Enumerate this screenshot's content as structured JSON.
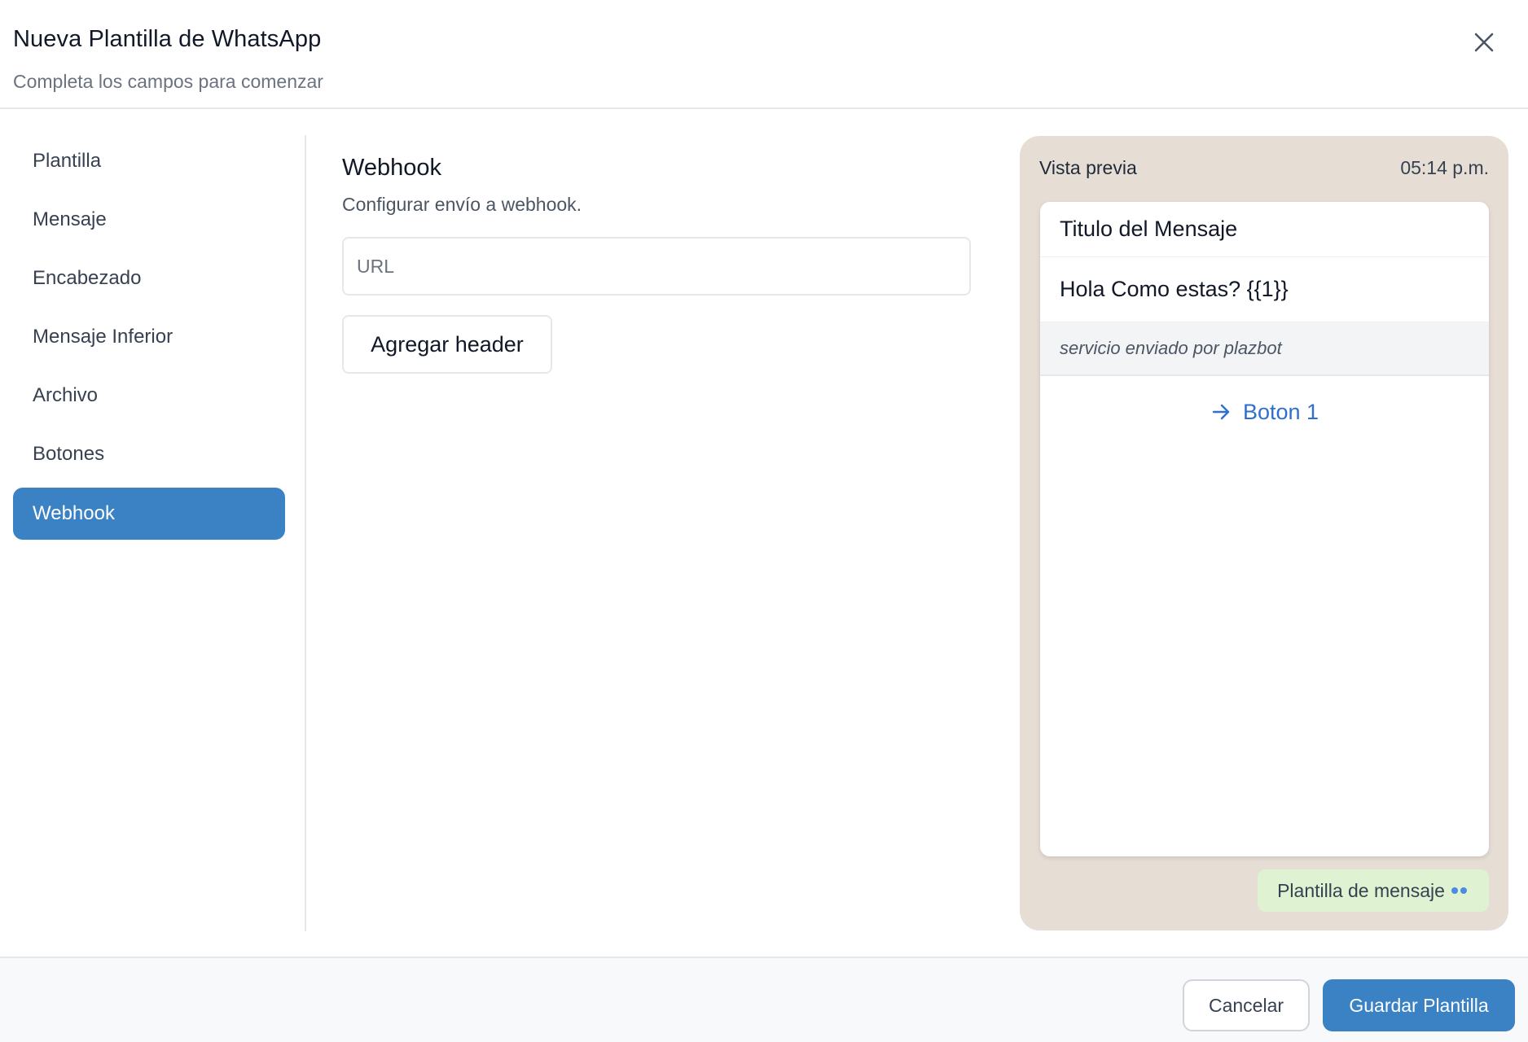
{
  "header": {
    "title": "Nueva Plantilla de WhatsApp",
    "subtitle": "Completa los campos para comenzar",
    "close_icon": "close-icon"
  },
  "sidebar": {
    "items": [
      {
        "label": "Plantilla",
        "active": false
      },
      {
        "label": "Mensaje",
        "active": false
      },
      {
        "label": "Encabezado",
        "active": false
      },
      {
        "label": "Mensaje Inferior",
        "active": false
      },
      {
        "label": "Archivo",
        "active": false
      },
      {
        "label": "Botones",
        "active": false
      },
      {
        "label": "Webhook",
        "active": true
      }
    ]
  },
  "main": {
    "section_title": "Webhook",
    "section_desc": "Configurar envío a webhook.",
    "url_placeholder": "URL",
    "url_value": "",
    "add_header_label": "Agregar header"
  },
  "preview": {
    "label": "Vista previa",
    "time": "05:14 p.m.",
    "card": {
      "title": "Titulo del Mensaje",
      "body": "Hola Como estas?  {{1}}",
      "footer": "servicio enviado por plazbot",
      "button_label": "Boton 1",
      "button_icon": "arrow-right-icon"
    },
    "tag": {
      "label": "Plantilla de mensaje",
      "icon": "double-check-icon"
    }
  },
  "footer": {
    "cancel_label": "Cancelar",
    "save_label": "Guardar Plantilla"
  },
  "colors": {
    "primary": "#3b82c4",
    "preview_bg": "#e6ded5",
    "link_blue": "#2f6fd0",
    "tag_bg": "#dff3d3"
  }
}
